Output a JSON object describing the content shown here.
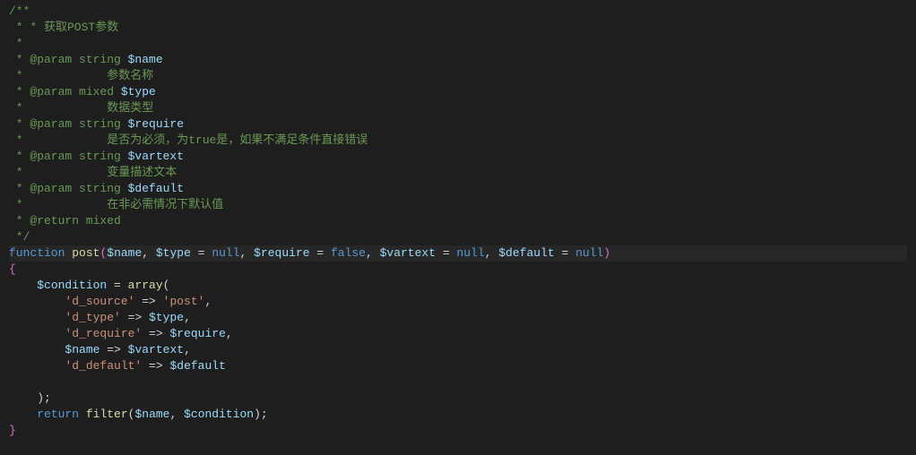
{
  "doc": {
    "open": "/**",
    "l1": " * * 获取POST参数",
    "l2": " *",
    "l3a": " * @param string ",
    "l3b": "$name",
    "l4": " *            参数名称",
    "l5a": " * @param mixed ",
    "l5b": "$type",
    "l6": " *            数据类型",
    "l7a": " * @param string ",
    "l7b": "$require",
    "l8": " *            是否为必须，为true是，如果不满足条件直接错误",
    "l9a": " * @param string ",
    "l9b": "$vartext",
    "l10": " *            变量描述文本",
    "l11a": " * @param string ",
    "l11b": "$default",
    "l12": " *            在非必需情况下默认值",
    "l13": " * @return mixed",
    "close": " */"
  },
  "sig": {
    "kw_function": "function",
    "name": "post",
    "p1": "$name",
    "p2": "$type",
    "p3": "$require",
    "p4": "$vartext",
    "p5": "$default",
    "kw_null": "null",
    "kw_false": "false",
    "comma": ", ",
    "eq": " = ",
    "open": "(",
    "close": ")"
  },
  "body": {
    "brace_open": "{",
    "brace_close": "}",
    "v_condition": "$condition",
    "kw_array": "array",
    "eq": " = ",
    "open": "(",
    "close": ");",
    "k_dsource": "'d_source'",
    "v_post": "'post'",
    "k_dtype": "'d_type'",
    "k_drequire": "'d_require'",
    "k_ddefault": "'d_default'",
    "arrow": " => ",
    "comma": ",",
    "kw_return": "return",
    "fn_filter": "filter",
    "semi": ";",
    "v_name": "$name",
    "v_type": "$type",
    "v_require": "$require",
    "v_vartext": "$vartext",
    "v_default": "$default"
  }
}
